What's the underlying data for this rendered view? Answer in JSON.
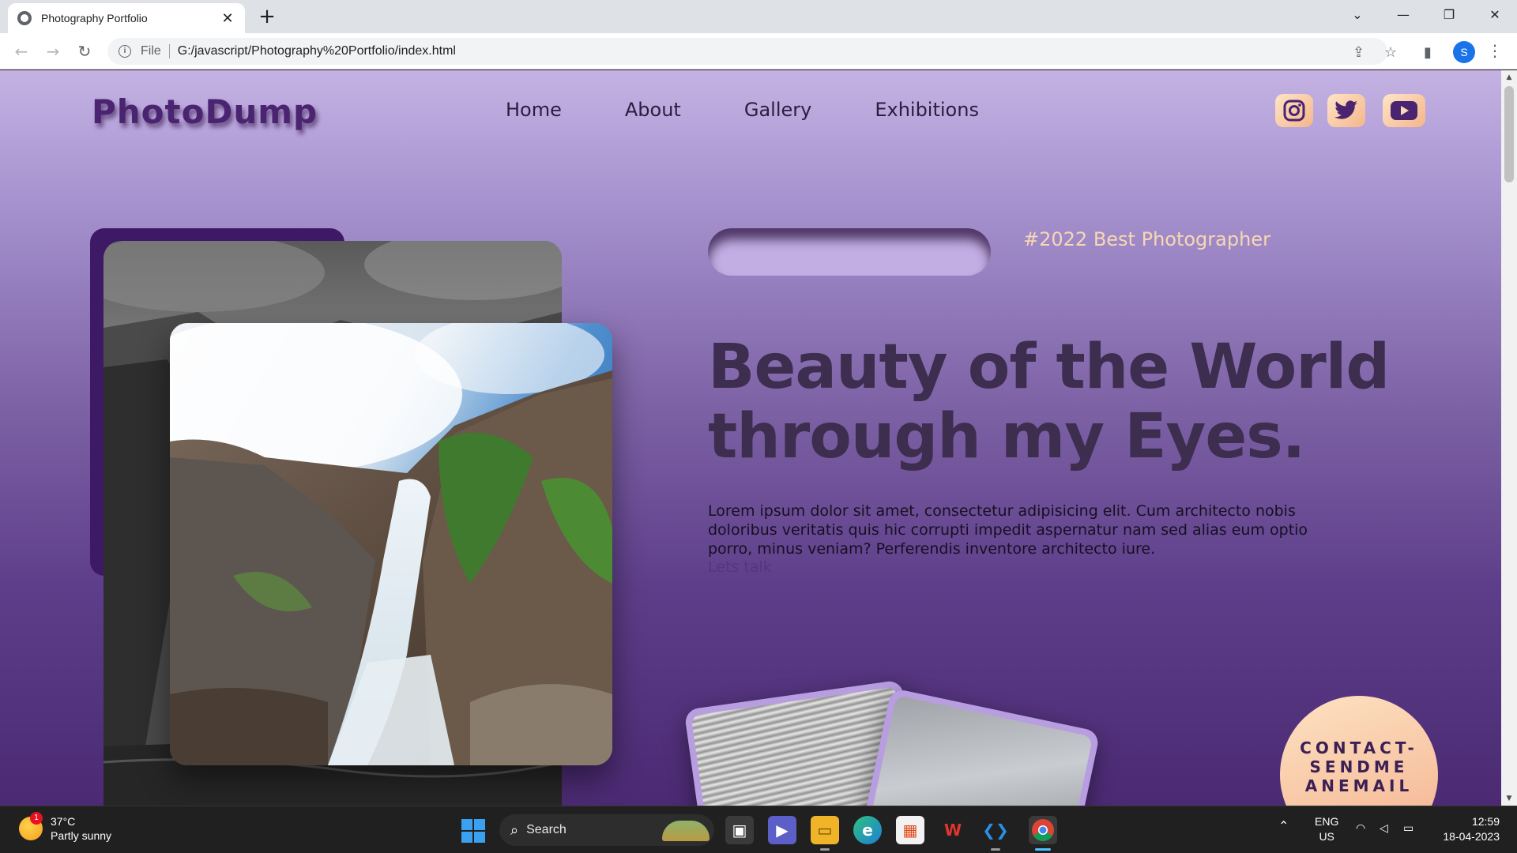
{
  "browser": {
    "tab_title": "Photography Portfolio",
    "tab_close": "✕",
    "new_tab": "+",
    "window_controls": {
      "minimize": "—",
      "maximize": "❐",
      "close": "✕",
      "tab_list": "⌄"
    },
    "scheme_label": "File",
    "url": "G:/javascript/Photography%20Portfolio/index.html",
    "profile_initial": "S"
  },
  "page": {
    "logo": "PhotoDump",
    "nav": [
      "Home",
      "About",
      "Gallery",
      "Exhibitions"
    ],
    "social": [
      "instagram-icon",
      "twitter-icon",
      "youtube-icon"
    ],
    "badge_text": "#2022 Best Photographer",
    "headline": "Beauty of the World through my Eyes.",
    "body": "Lorem ipsum dolor sit amet, consectetur adipisicing elit. Cum architecto nobis doloribus veritatis quis hic corrupti impedit aspernatur nam sed alias eum optio porro, minus veniam? Perferendis inventore architecto iure.",
    "cta_link": "Lets talk",
    "contact_circle": "CONTACT-SENDME ANEMAIL",
    "colors": {
      "accent": "#f8d7b4",
      "logo": "#4a2470",
      "frame": "#3e1a66"
    }
  },
  "taskbar": {
    "weather_temp": "37°C",
    "weather_desc": "Partly sunny",
    "weather_badge": "1",
    "search_label": "Search",
    "lang_top": "ENG",
    "lang_bottom": "US",
    "time": "12:59",
    "date": "18-04-2023"
  }
}
